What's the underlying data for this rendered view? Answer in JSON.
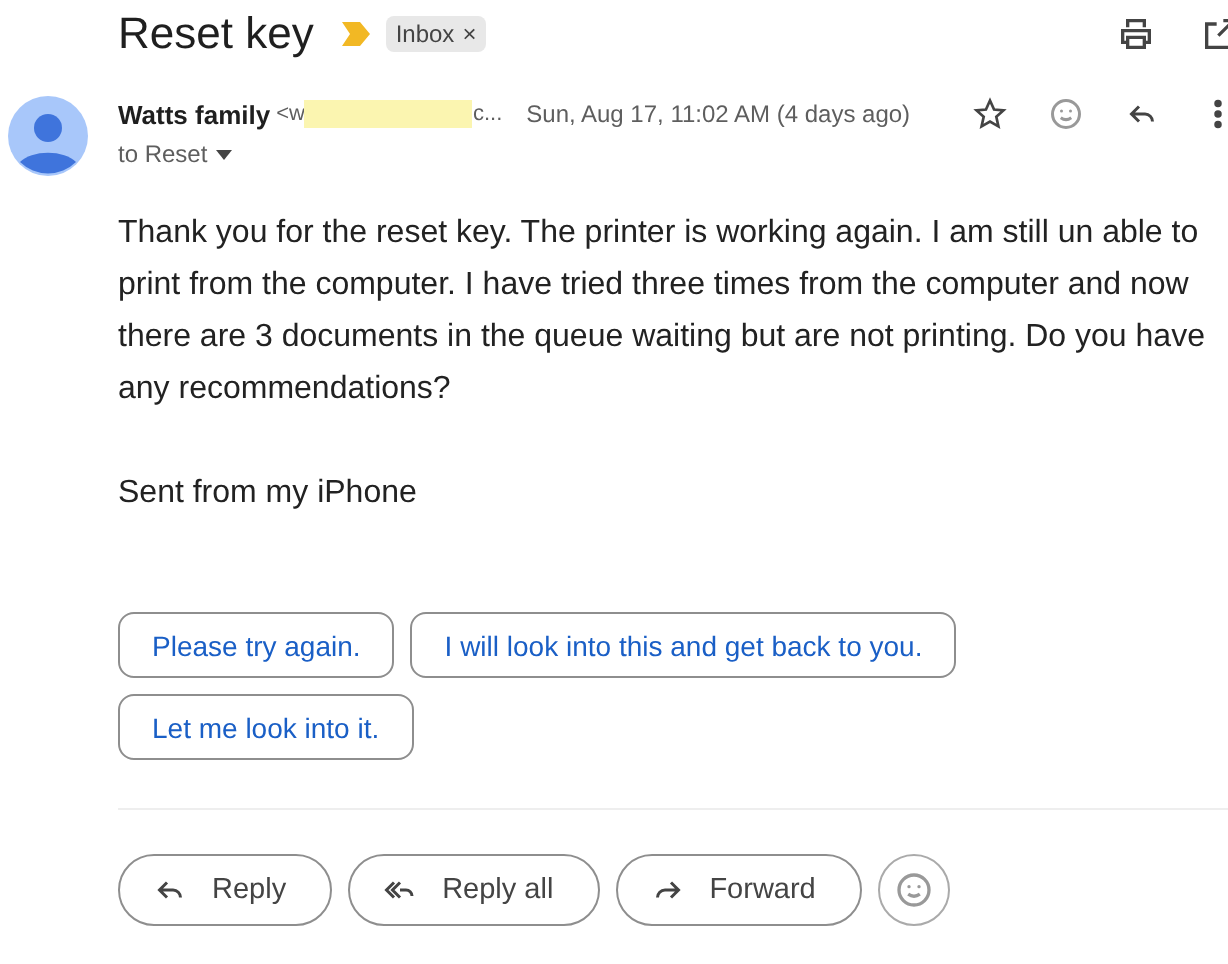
{
  "subject": "Reset key",
  "label_chip": {
    "label": "Inbox",
    "remove": "×"
  },
  "message": {
    "sender": "Watts family",
    "email_start": "<w",
    "email_end": "c...",
    "redacted": true,
    "date": "Sun, Aug 17, 11:02 AM (4 days ago)",
    "recipient": "to Reset",
    "starred": false
  },
  "body": [
    "Thank you for the reset key. The printer is working again. I am still un able to print from the computer. I have tried three times from the computer and now there are 3 documents in the queue waiting but are not printing. Do you have any recommendations?",
    "Sent from my iPhone"
  ],
  "smart_replies": [
    "Please try again.",
    "I will look into this and get back to you.",
    "Let me look into it."
  ],
  "actions": [
    {
      "kind": "reply",
      "label": "Reply"
    },
    {
      "kind": "reply_all",
      "label": "Reply all"
    },
    {
      "kind": "forward",
      "label": "Forward"
    }
  ]
}
